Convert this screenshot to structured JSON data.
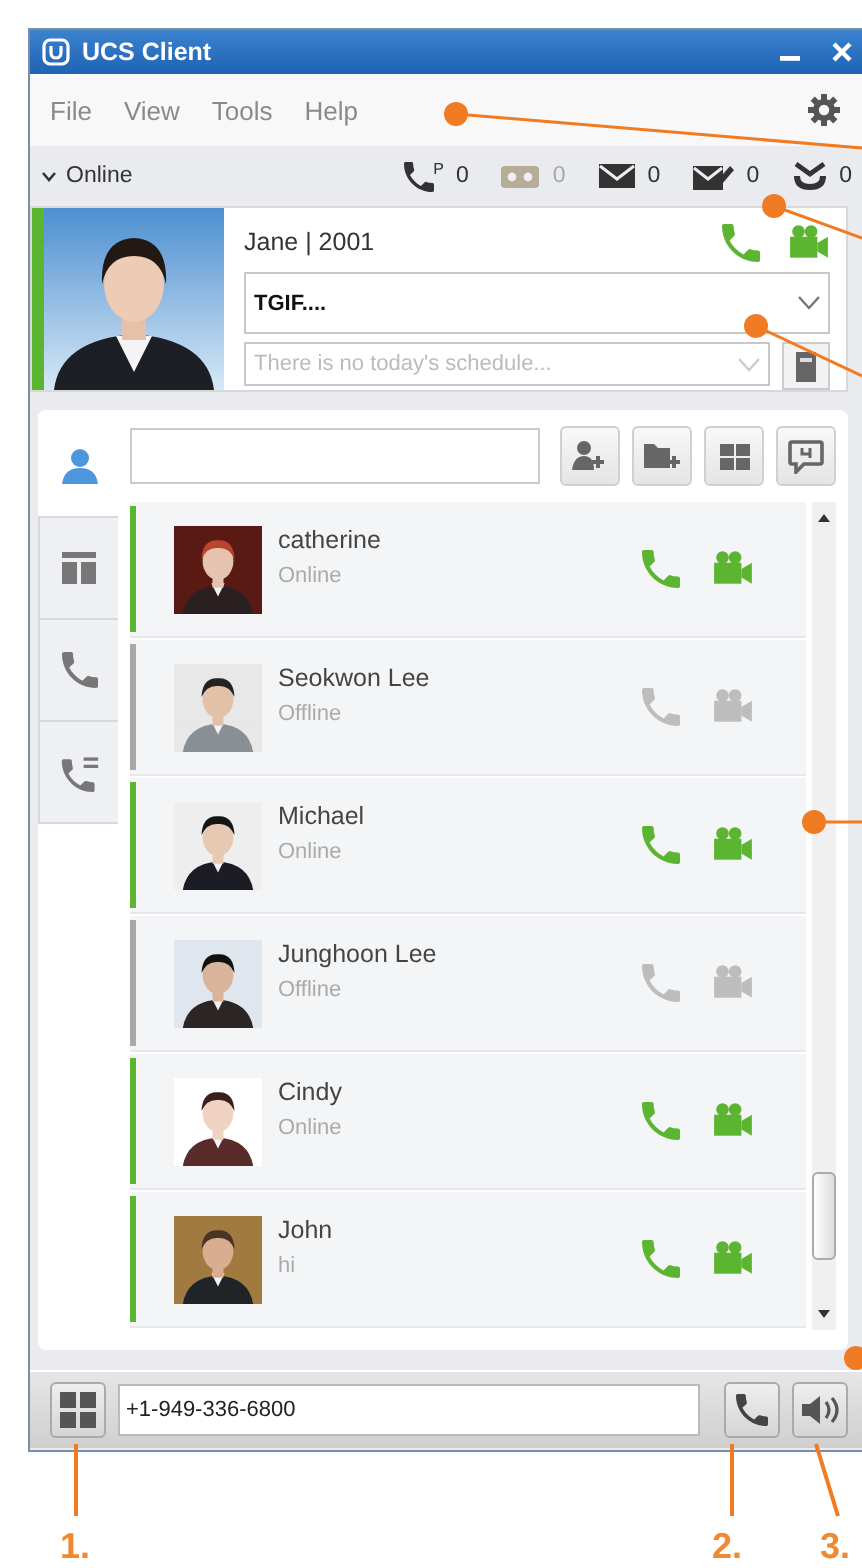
{
  "window": {
    "title": "UCS Client"
  },
  "menu": [
    "File",
    "View",
    "Tools",
    "Help"
  ],
  "presence": {
    "label": "Online"
  },
  "counters": [
    {
      "kind": "missed_call",
      "mark": "P",
      "count": "0",
      "dimmed": false
    },
    {
      "kind": "voicemail",
      "count": "0",
      "dimmed": true
    },
    {
      "kind": "message",
      "count": "0",
      "dimmed": false
    },
    {
      "kind": "note",
      "count": "0",
      "dimmed": false
    },
    {
      "kind": "inbox",
      "count": "0",
      "dimmed": false
    }
  ],
  "profile": {
    "name": "Jane | 2001",
    "online": true,
    "status_message": "TGIF....",
    "schedule": {
      "placeholder": "There is no today's schedule..."
    }
  },
  "side_tabs": [
    {
      "kind": "contacts",
      "selected": true
    },
    {
      "kind": "groups",
      "selected": false
    },
    {
      "kind": "calls",
      "selected": false
    },
    {
      "kind": "call_log",
      "selected": false
    }
  ],
  "toolbar": [
    {
      "kind": "add_contact"
    },
    {
      "kind": "add_group"
    },
    {
      "kind": "grid"
    },
    {
      "kind": "chat"
    }
  ],
  "contacts": [
    {
      "name": "catherine",
      "status": "Online",
      "online": true
    },
    {
      "name": "Seokwon Lee",
      "status": "Offline",
      "online": false
    },
    {
      "name": "Michael",
      "status": "Online",
      "online": true
    },
    {
      "name": "Junghoon Lee",
      "status": "Offline",
      "online": false
    },
    {
      "name": "Cindy",
      "status": "Online",
      "online": true
    },
    {
      "name": "John",
      "status": "hi",
      "online": true
    }
  ],
  "dial": {
    "value": "+1-949-336-6800"
  },
  "callouts": [
    {
      "label": "1."
    },
    {
      "label": "2."
    },
    {
      "label": "3."
    }
  ]
}
